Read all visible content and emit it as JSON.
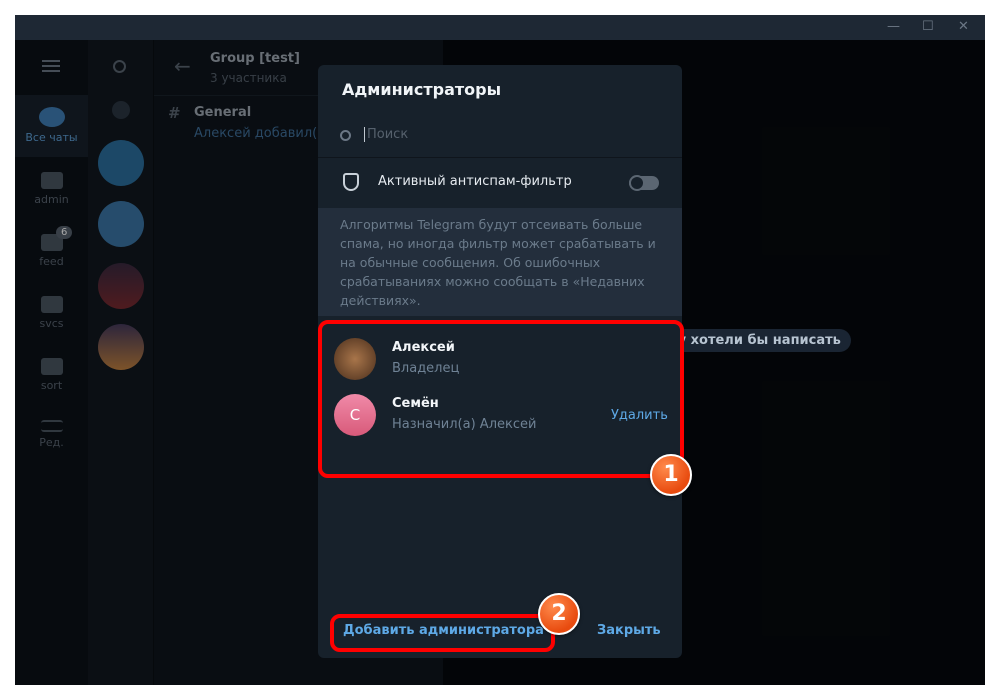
{
  "window": {
    "minimize": "—",
    "maximize": "☐",
    "close": "✕"
  },
  "folders": [
    {
      "label": "Все чаты",
      "active": true
    },
    {
      "label": "admin"
    },
    {
      "label": "feed",
      "badge": "6"
    },
    {
      "label": "svcs"
    },
    {
      "label": "sort"
    },
    {
      "label": "Ред."
    }
  ],
  "chat_header": {
    "title": "Group [test]",
    "subtitle": "3 участника"
  },
  "topic": {
    "icon": "#",
    "name": "General",
    "preview": "Алексей добавил(а) С"
  },
  "chat_hint": "му хотели бы написать",
  "dialog": {
    "title": "Администраторы",
    "search_placeholder": "Поиск",
    "antispam_label": "Активный антиспам-фильтр",
    "antispam_enabled": false,
    "note": "Алгоритмы Telegram будут отсеивать больше спама, но иногда фильтр может срабатывать и на обычные сообщения. Об ошибочных срабатываниях можно сообщать в «Недавних действиях».",
    "members": [
      {
        "name": "Алексей",
        "role": "Владелец"
      },
      {
        "name": "Семён",
        "initial": "С",
        "role": "Назначил(а) Алексей",
        "action": "Удалить"
      }
    ],
    "add_admin": "Добавить администратора",
    "close": "Закрыть"
  },
  "callouts": [
    "1",
    "2"
  ],
  "colors": {
    "accent": "#5ea9e6",
    "callout": "#ff0000",
    "avatar_semen": "#e0708f"
  }
}
